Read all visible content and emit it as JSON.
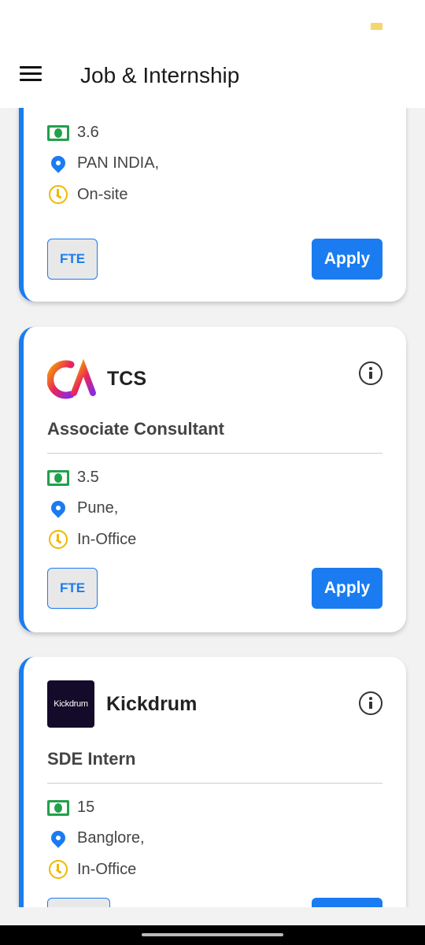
{
  "app_bar": {
    "title": "Job & Internship"
  },
  "jobs": [
    {
      "company": "",
      "role": "",
      "salary": "3.6",
      "location": "PAN INDIA,",
      "work_mode": "On-site",
      "type": "FTE",
      "apply_label": "Apply"
    },
    {
      "company": "TCS",
      "role": "Associate Consultant",
      "salary": "3.5",
      "location": "Pune,",
      "work_mode": "In-Office",
      "type": "FTE",
      "apply_label": "Apply"
    },
    {
      "company": "Kickdrum",
      "logo_text": "Kickdrum",
      "role": "SDE Intern",
      "salary": "15",
      "location": "Banglore,",
      "work_mode": "In-Office",
      "type": "",
      "apply_label": ""
    }
  ],
  "colors": {
    "accent": "#1a7cf0",
    "money": "#23a04b",
    "clock": "#f0b800"
  }
}
